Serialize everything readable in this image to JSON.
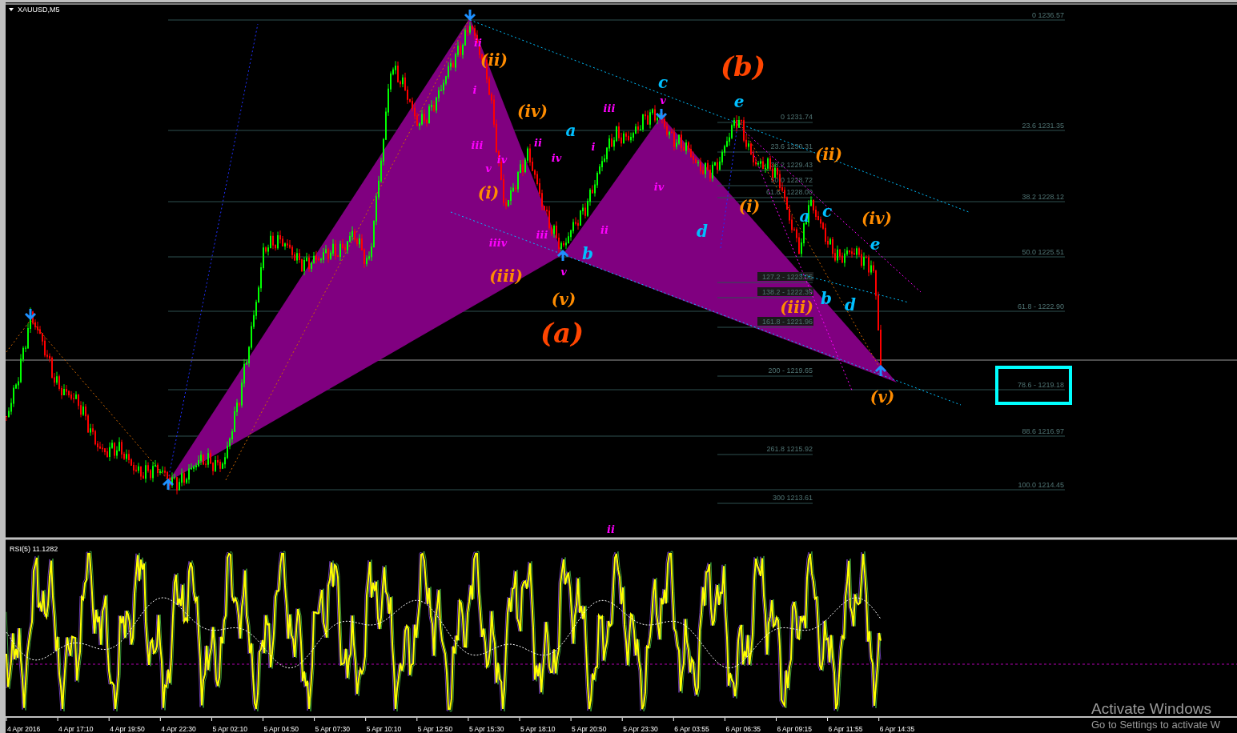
{
  "chart_window": {
    "symbol": "XAUUSD,M5"
  },
  "fib_main": [
    "0 1236.57",
    "23.6 1231.35",
    "38.2 1228.12",
    "50.0 1225.51",
    "61.8 - 1222.90",
    "78.6 - 1219.18",
    "88.6 1216.97",
    "100.0 1214.45"
  ],
  "fib_inner": [
    "0 1231.74",
    "23.6 1230.31",
    "38.2 1229.43",
    "50.0 1228.72",
    "61.8 - 1228.00",
    "127.2 - 1223.05",
    "138.2 - 1222.39",
    "161.8 - 1221.96",
    "200 - 1219.65",
    "261.8 1215.92",
    "300 1213.61"
  ],
  "wave_labels": [
    {
      "text": "(ii)",
      "color": "#ff8c00",
      "kind": "medium"
    },
    {
      "text": "(iv)",
      "color": "#ff8c00",
      "kind": "medium"
    },
    {
      "text": "(i)",
      "color": "#ff8c00",
      "kind": "medium"
    },
    {
      "text": "(iii)",
      "color": "#ff8c00",
      "kind": "medium"
    },
    {
      "text": "(v)",
      "color": "#ff8c00",
      "kind": "medium"
    },
    {
      "text": "(a)",
      "color": "#ff4500",
      "kind": "large"
    },
    {
      "text": "(b)",
      "color": "#ff4500",
      "kind": "large"
    },
    {
      "text": "(ii)",
      "color": "#ff8c00",
      "kind": "medium"
    },
    {
      "text": "(i)",
      "color": "#ff8c00",
      "kind": "medium"
    },
    {
      "text": "(iii)",
      "color": "#ff8c00",
      "kind": "medium"
    },
    {
      "text": "(iv)",
      "color": "#ff8c00",
      "kind": "medium"
    },
    {
      "text": "(v)",
      "color": "#ff8c00",
      "kind": "medium"
    },
    {
      "text": "c",
      "color": "#00bfff",
      "kind": "medium"
    },
    {
      "text": "e",
      "color": "#00bfff",
      "kind": "medium"
    },
    {
      "text": "a",
      "color": "#00bfff",
      "kind": "medium"
    },
    {
      "text": "b",
      "color": "#00bfff",
      "kind": "medium"
    },
    {
      "text": "d",
      "color": "#00bfff",
      "kind": "medium"
    },
    {
      "text": "a",
      "color": "#00bfff",
      "kind": "medium"
    },
    {
      "text": "c",
      "color": "#00bfff",
      "kind": "medium"
    },
    {
      "text": "b",
      "color": "#00bfff",
      "kind": "medium"
    },
    {
      "text": "d",
      "color": "#00bfff",
      "kind": "medium"
    },
    {
      "text": "e",
      "color": "#00bfff",
      "kind": "medium"
    },
    {
      "text": "ii",
      "color": "#ff00ff",
      "kind": "small"
    },
    {
      "text": "i",
      "color": "#ff00ff",
      "kind": "small"
    },
    {
      "text": "iii",
      "color": "#ff00ff",
      "kind": "small"
    },
    {
      "text": "iv",
      "color": "#ff00ff",
      "kind": "small"
    },
    {
      "text": "v",
      "color": "#ff00ff",
      "kind": "small"
    },
    {
      "text": "iiiv",
      "color": "#ff00ff",
      "kind": "small"
    },
    {
      "text": "ii",
      "color": "#ff00ff",
      "kind": "small"
    },
    {
      "text": "iv",
      "color": "#ff00ff",
      "kind": "small"
    },
    {
      "text": "iii",
      "color": "#ff00ff",
      "kind": "small"
    },
    {
      "text": "v",
      "color": "#ff00ff",
      "kind": "small"
    },
    {
      "text": "iii",
      "color": "#ff00ff",
      "kind": "small"
    },
    {
      "text": "i",
      "color": "#ff00ff",
      "kind": "small"
    },
    {
      "text": "v",
      "color": "#ff00ff",
      "kind": "small"
    },
    {
      "text": "iv",
      "color": "#ff00ff",
      "kind": "small"
    },
    {
      "text": "ii",
      "color": "#ff00ff",
      "kind": "small"
    },
    {
      "text": "ii",
      "color": "#ff00ff",
      "kind": "small"
    }
  ],
  "rsi_panel": {
    "label": "RSI(5) 11.1282"
  },
  "time_axis": [
    "4 Apr 2016",
    "4 Apr 17:10",
    "4 Apr 19:50",
    "4 Apr 22:30",
    "5 Apr 02:10",
    "5 Apr 04:50",
    "5 Apr 07:30",
    "5 Apr 10:10",
    "5 Apr 12:50",
    "5 Apr 15:30",
    "5 Apr 18:10",
    "5 Apr 20:50",
    "5 Apr 23:30",
    "6 Apr 03:55",
    "6 Apr 06:35",
    "6 Apr 09:15",
    "6 Apr 11:55",
    "6 Apr 14:35"
  ],
  "windows_notice": {
    "title": "Activate Windows",
    "text": "Go to Settings to activate W"
  }
}
